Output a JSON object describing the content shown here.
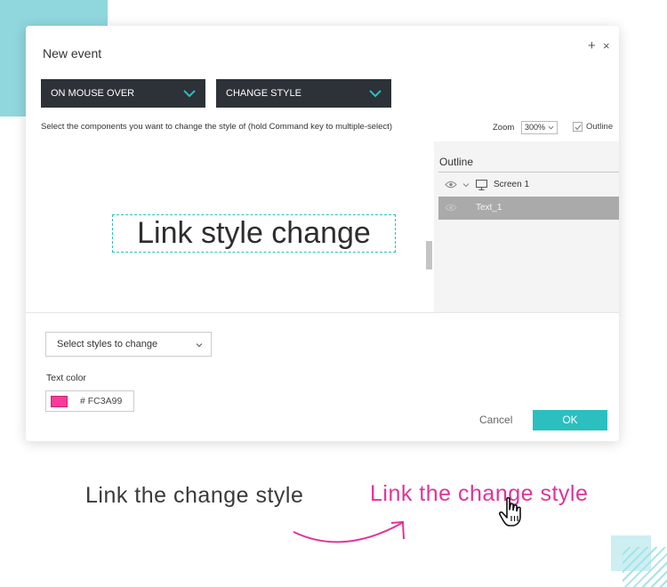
{
  "dialog": {
    "title": "New event",
    "plus_icon": "+",
    "close_icon": "×",
    "event_dropdown": "ON MOUSE OVER",
    "action_dropdown": "CHANGE STYLE",
    "instructions": "Select the components you want to change the style of (hold Command key to multiple-select)",
    "zoom_label": "Zoom",
    "zoom_value": "300%",
    "outline_toggle_label": "Outline",
    "outline_toggle_checked": true,
    "canvas_text": "Link style change",
    "outline_panel": {
      "title": "Outline",
      "items": [
        {
          "label": "Screen 1",
          "icon": "monitor-icon",
          "selected": false
        },
        {
          "label": "Text_1",
          "icon": "",
          "selected": true
        }
      ]
    },
    "styles_select_placeholder": "Select styles to change",
    "text_color_label": "Text color",
    "text_color_hash": "#",
    "text_color_value": "FC3A99",
    "cancel_label": "Cancel",
    "ok_label": "OK"
  },
  "captions": {
    "before": "Link the change style",
    "after": "Link the change style"
  },
  "colors": {
    "accent": "#2bbfbf",
    "dropdown_bg": "#2d3138",
    "link_hover": "#e0349a",
    "swatch": "#fc3a99",
    "deco_teal": "#8fd6dd"
  }
}
